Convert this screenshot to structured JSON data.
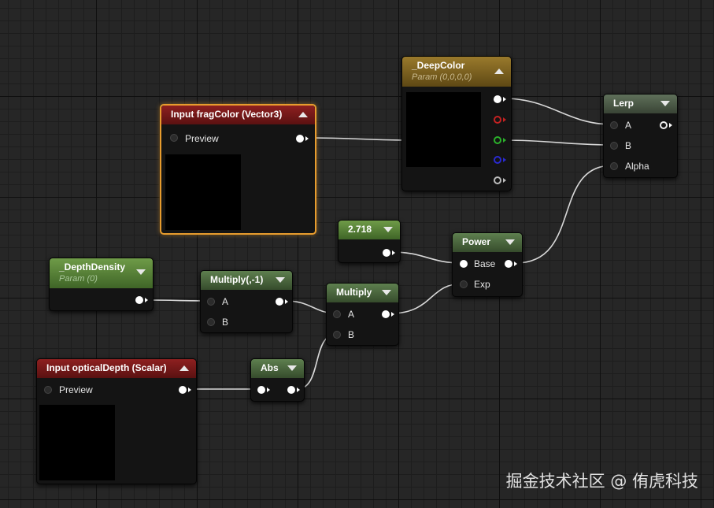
{
  "nodes": {
    "frag_color": {
      "title": "Input fragColor (Vector3)",
      "preview_label": "Preview"
    },
    "deep_color": {
      "title": "_DeepColor",
      "subtitle": "Param (0,0,0,0)"
    },
    "lerp": {
      "title": "Lerp",
      "pin_a": "A",
      "pin_b": "B",
      "pin_alpha": "Alpha"
    },
    "const_e": {
      "title": "2.718"
    },
    "power": {
      "title": "Power",
      "pin_base": "Base",
      "pin_exp": "Exp"
    },
    "depth_density": {
      "title": "_DepthDensity",
      "subtitle": "Param (0)"
    },
    "multiply_neg": {
      "title": "Multiply(,-1)",
      "pin_a": "A",
      "pin_b": "B"
    },
    "multiply": {
      "title": "Multiply",
      "pin_a": "A",
      "pin_b": "B"
    },
    "optical_depth": {
      "title": "Input opticalDepth (Scalar)",
      "preview_label": "Preview"
    },
    "abs": {
      "title": "Abs"
    }
  },
  "watermark": "掘金技术社区 @ 侑虎科技",
  "colors": {
    "selection_outline": "#e79c2e",
    "input_header": "#8e2020",
    "param_header": "#9a7a2c",
    "scalar_param_header": "#6f9b48",
    "math_header": "#5e7f4f",
    "wire": "#d8d8d8"
  }
}
